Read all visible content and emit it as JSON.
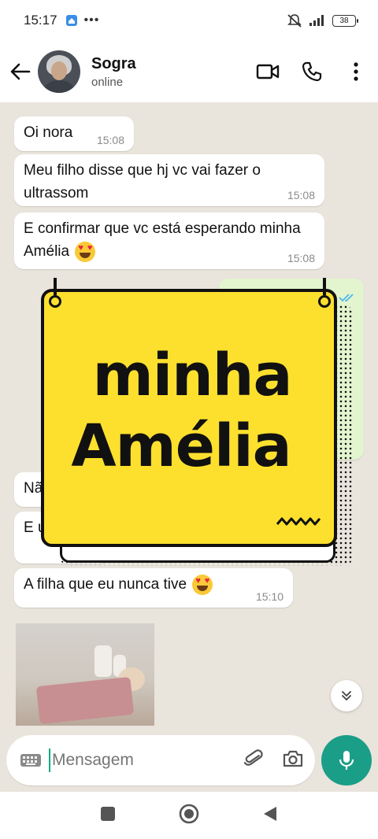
{
  "status_bar": {
    "time": "15:17",
    "battery": "38"
  },
  "header": {
    "contact_name": "Sogra",
    "contact_status": "online"
  },
  "messages": [
    {
      "text": "Oi nora",
      "time": "15:08"
    },
    {
      "text": "Meu filho disse que hj vc vai fazer o ultrassom",
      "time": "15:08"
    },
    {
      "text": "E confirmar que vc está esperando minha Amélia",
      "time": "15:08"
    },
    {
      "text": "Nã",
      "time": ""
    },
    {
      "text": "E u",
      "time": ""
    },
    {
      "text": "A filha que eu nunca tive",
      "time": "15:10"
    }
  ],
  "overlay": {
    "line1": "minha",
    "line2": "Amélia"
  },
  "input": {
    "placeholder": "Mensagem"
  },
  "colors": {
    "accent": "#1a9e87",
    "sign_yellow": "#fde02e",
    "chat_bg": "#e9e4dc"
  },
  "icons": [
    "back-arrow-icon",
    "video-call-icon",
    "phone-icon",
    "more-vert-icon",
    "keyboard-icon",
    "attach-icon",
    "camera-icon",
    "mic-icon",
    "chevron-double-down-icon",
    "heart-eyes-emoji"
  ]
}
